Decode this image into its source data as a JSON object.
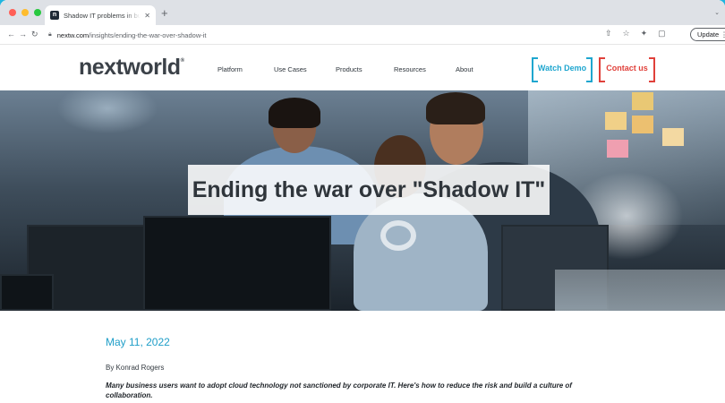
{
  "browser": {
    "tab_title": "Shadow IT problems in business",
    "tab_favicon_letter": "n",
    "url_host": "nextw.com",
    "url_path": "/insights/ending-the-war-over-shadow-it",
    "update_label": "Update",
    "icons": [
      "back-icon",
      "forward-icon",
      "reload-icon",
      "lock-icon",
      "share-icon",
      "star-icon",
      "extensions-icon",
      "sidebar-icon",
      "menu-icon"
    ]
  },
  "site": {
    "logo": "nextworld",
    "nav": {
      "platform": "Platform",
      "use_cases": "Use Cases",
      "products": "Products",
      "resources": "Resources",
      "about": "About"
    },
    "cta_demo": "Watch Demo",
    "cta_contact": "Contact us",
    "colors": {
      "accent_blue": "#1fa6cf",
      "accent_red": "#e0403a",
      "page_frame": "#20b6e0"
    }
  },
  "hero": {
    "title": "Ending the war over \"Shadow IT\""
  },
  "article": {
    "date": "May 11, 2022",
    "byline": "By Konrad Rogers",
    "summary": "Many business users want to adopt cloud technology not sanctioned by corporate IT. Here's how to reduce the risk and build a culture of collaboration."
  }
}
